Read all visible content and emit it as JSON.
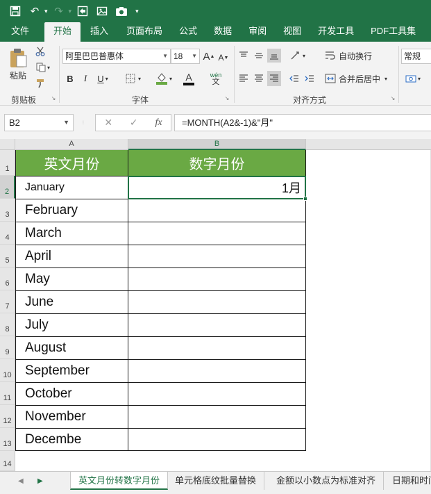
{
  "quick_access": {
    "save_icon": "save-icon",
    "undo_icon": "undo-icon",
    "redo_icon": "redo-icon"
  },
  "ribbon_tabs": [
    "文件",
    "开始",
    "插入",
    "页面布局",
    "公式",
    "数据",
    "审阅",
    "视图",
    "开发工具",
    "PDF工具集"
  ],
  "active_tab": "开始",
  "ribbon": {
    "clipboard": {
      "paste_label": "粘贴",
      "group_label": "剪贴板"
    },
    "font": {
      "font_name": "阿里巴巴普惠体",
      "font_size": "18",
      "bold": "B",
      "italic": "I",
      "underline": "U",
      "grow": "A",
      "shrink": "A",
      "phonetic": "wén",
      "font_color": "A",
      "group_label": "字体"
    },
    "alignment": {
      "wrap_text": "自动换行",
      "merge_center": "合并后居中",
      "group_label": "对齐方式"
    },
    "number": {
      "format": "常规"
    }
  },
  "formula_bar": {
    "name_box": "B2",
    "fx": "fx",
    "formula": "=MONTH(A2&-1)&\"月\""
  },
  "columns": [
    "A",
    "B"
  ],
  "selected_column": "B",
  "rows": [
    "1",
    "2",
    "3",
    "4",
    "5",
    "6",
    "7",
    "8",
    "9",
    "10",
    "11",
    "12",
    "13",
    "14"
  ],
  "selected_row": "2",
  "table": {
    "headers": [
      "英文月份",
      "数字月份"
    ],
    "months": [
      "January",
      "February",
      "March",
      "April",
      "May",
      "June",
      "July",
      "August",
      "September",
      "October",
      "November",
      "Decembe"
    ],
    "results": [
      "1月",
      "",
      "",
      "",
      "",
      "",
      "",
      "",
      "",
      "",
      "",
      ""
    ]
  },
  "sheet_tabs": [
    "英文月份转数字月份",
    "单元格底纹批量替换",
    "金额以小数点为标准对齐",
    "日期和时间"
  ],
  "active_sheet": "英文月份转数字月份",
  "colors": {
    "brand": "#217346",
    "header_fill": "#6aa944"
  }
}
